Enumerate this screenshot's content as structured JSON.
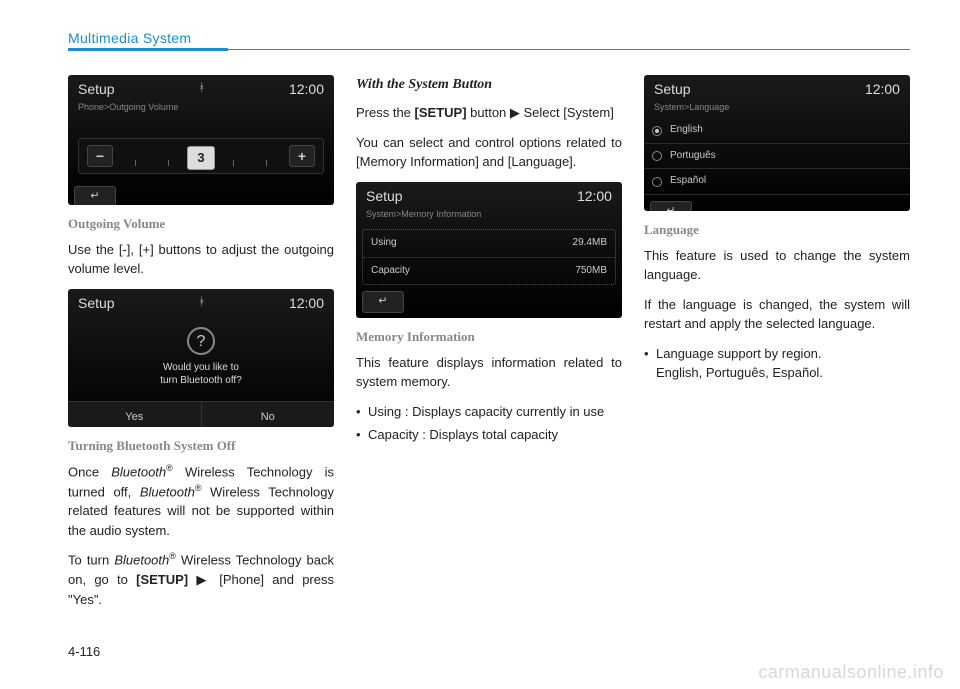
{
  "header": {
    "title": "Multimedia System"
  },
  "page_number": "4-116",
  "watermark": "carmanualsonline.info",
  "col1": {
    "screen1": {
      "title": "Setup",
      "clock": "12:00",
      "breadcrumb": "Phone>Outgoing Volume",
      "minus": "−",
      "plus": "+",
      "handle": "3",
      "back": "↵"
    },
    "h1": "Outgoing Volume",
    "p1": "Use the [-], [+] buttons to adjust the outgoing volume level.",
    "screen2": {
      "title": "Setup",
      "clock": "12:00",
      "question": "?",
      "line1": "Would you like to",
      "line2": "turn Bluetooth off?",
      "yes": "Yes",
      "no": "No"
    },
    "h2": "Turning Bluetooth System Off",
    "p2a_1": "Once ",
    "p2a_bt1": "Bluetooth",
    "p2a_r1": "®",
    "p2a_2": " Wireless Technology is turned off, ",
    "p2a_bt2": "Bluetooth",
    "p2a_r2": "®",
    "p2a_3": " Wireless Technology related features will not be supported within the audio system.",
    "p2b_1": "To turn ",
    "p2b_bt": "Bluetooth",
    "p2b_r": "®",
    "p2b_2": " Wireless Technology back on, go to ",
    "p2b_setup": "[SETUP]",
    "p2b_3": " ▶ [Phone] and press \"Yes\"."
  },
  "col2": {
    "h1": "With the System Button",
    "p1_1": "Press the ",
    "p1_setup": "[SETUP]",
    "p1_2": " button ▶ Select [System]",
    "p2": "You can select and control options related to [Memory Information] and [Language].",
    "screen": {
      "title": "Setup",
      "clock": "12:00",
      "breadcrumb": "System>Memory Information",
      "using_label": "Using",
      "using_val": "29.4MB",
      "cap_label": "Capacity",
      "cap_val": "750MB",
      "back": "↵"
    },
    "h2": "Memory Information",
    "p3": "This feature displays information related to system memory.",
    "b1": "Using : Displays capacity currently in use",
    "b2": "Capacity : Displays total capacity"
  },
  "col3": {
    "screen": {
      "title": "Setup",
      "clock": "12:00",
      "breadcrumb": "System>Language",
      "opt1": "English",
      "opt2": "Português",
      "opt3": "Español",
      "back": "↵"
    },
    "h1": "Language",
    "p1": "This feature is used to change the system language.",
    "p2": "If the language is changed, the system will restart and apply the selected language.",
    "b1": "Language support by region.",
    "b1_sub": "English, Português, Español."
  }
}
